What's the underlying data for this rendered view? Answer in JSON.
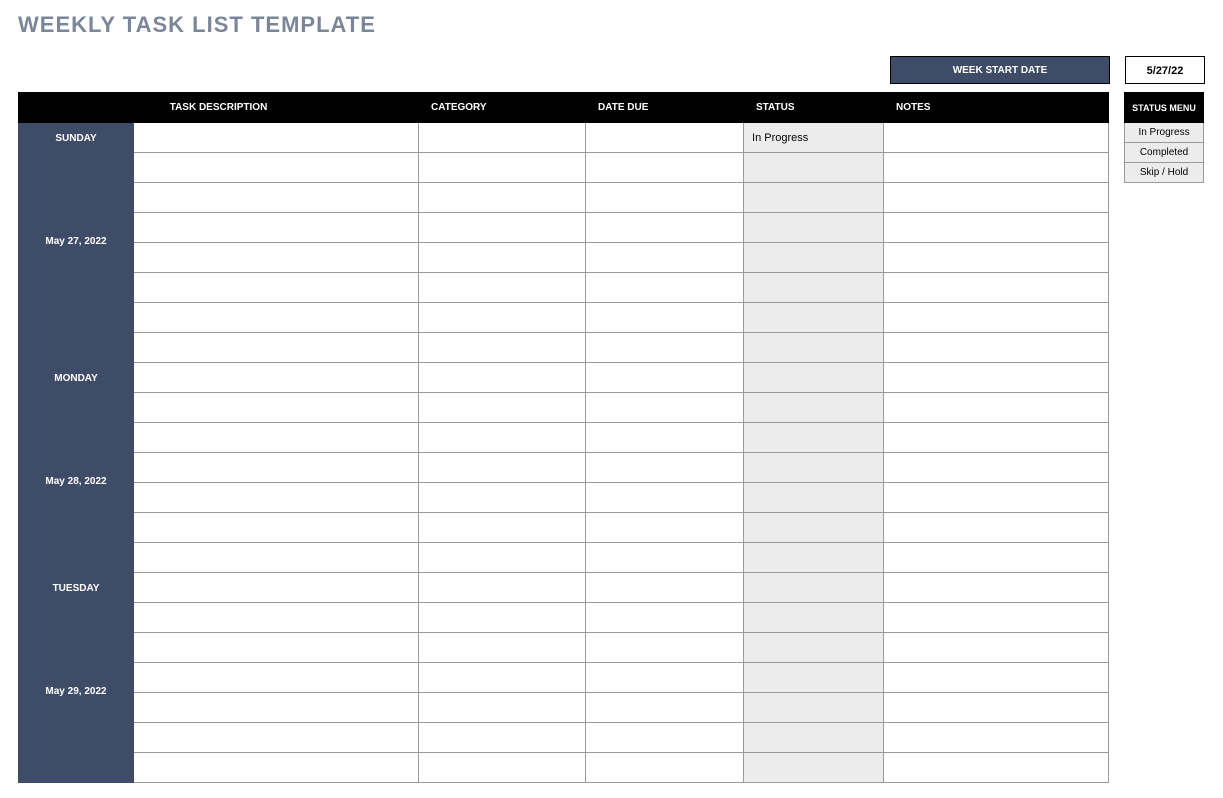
{
  "title": "WEEKLY TASK LIST TEMPLATE",
  "week_start_date_label": "WEEK START DATE",
  "week_start_date_value": "5/27/22",
  "columns": {
    "task_description": "TASK DESCRIPTION",
    "category": "CATEGORY",
    "date_due": "DATE DUE",
    "status": "STATUS",
    "notes": "NOTES"
  },
  "status_menu": {
    "header": "STATUS MENU",
    "options": [
      "In Progress",
      "Completed",
      "Skip / Hold"
    ]
  },
  "days": [
    {
      "name": "SUNDAY",
      "date": "May 27, 2022",
      "rows": [
        {
          "desc": "",
          "cat": "",
          "due": "",
          "status": "In Progress",
          "notes": ""
        },
        {
          "desc": "",
          "cat": "",
          "due": "",
          "status": "",
          "notes": ""
        },
        {
          "desc": "",
          "cat": "",
          "due": "",
          "status": "",
          "notes": ""
        },
        {
          "desc": "",
          "cat": "",
          "due": "",
          "status": "",
          "notes": ""
        },
        {
          "desc": "",
          "cat": "",
          "due": "",
          "status": "",
          "notes": ""
        },
        {
          "desc": "",
          "cat": "",
          "due": "",
          "status": "",
          "notes": ""
        },
        {
          "desc": "",
          "cat": "",
          "due": "",
          "status": "",
          "notes": ""
        },
        {
          "desc": "",
          "cat": "",
          "due": "",
          "status": "",
          "notes": ""
        }
      ]
    },
    {
      "name": "MONDAY",
      "date": "May 28, 2022",
      "rows": [
        {
          "desc": "",
          "cat": "",
          "due": "",
          "status": "",
          "notes": ""
        },
        {
          "desc": "",
          "cat": "",
          "due": "",
          "status": "",
          "notes": ""
        },
        {
          "desc": "",
          "cat": "",
          "due": "",
          "status": "",
          "notes": ""
        },
        {
          "desc": "",
          "cat": "",
          "due": "",
          "status": "",
          "notes": ""
        },
        {
          "desc": "",
          "cat": "",
          "due": "",
          "status": "",
          "notes": ""
        },
        {
          "desc": "",
          "cat": "",
          "due": "",
          "status": "",
          "notes": ""
        },
        {
          "desc": "",
          "cat": "",
          "due": "",
          "status": "",
          "notes": ""
        }
      ]
    },
    {
      "name": "TUESDAY",
      "date": "May 29, 2022",
      "rows": [
        {
          "desc": "",
          "cat": "",
          "due": "",
          "status": "",
          "notes": ""
        },
        {
          "desc": "",
          "cat": "",
          "due": "",
          "status": "",
          "notes": ""
        },
        {
          "desc": "",
          "cat": "",
          "due": "",
          "status": "",
          "notes": ""
        },
        {
          "desc": "",
          "cat": "",
          "due": "",
          "status": "",
          "notes": ""
        },
        {
          "desc": "",
          "cat": "",
          "due": "",
          "status": "",
          "notes": ""
        },
        {
          "desc": "",
          "cat": "",
          "due": "",
          "status": "",
          "notes": ""
        },
        {
          "desc": "",
          "cat": "",
          "due": "",
          "status": "",
          "notes": ""
        }
      ]
    }
  ]
}
